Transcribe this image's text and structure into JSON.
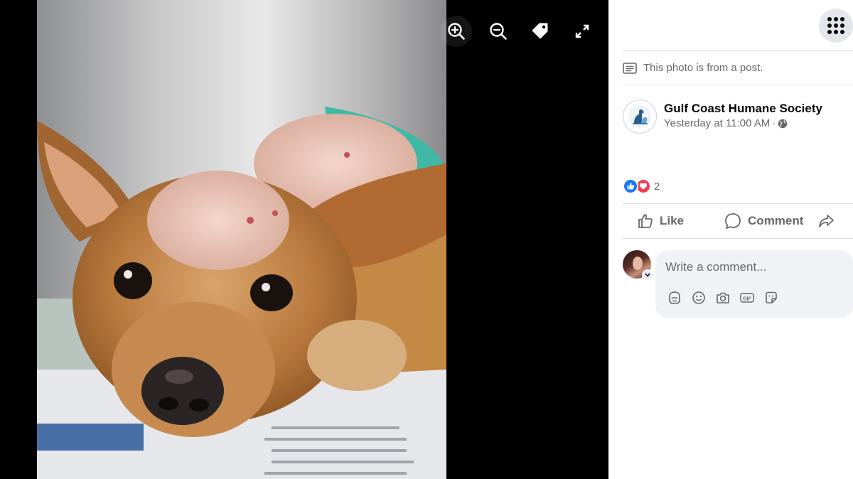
{
  "viewer": {
    "photo_alt": "",
    "tools": [
      {
        "icon": "zoom-in-icon"
      },
      {
        "icon": "zoom-out-icon"
      },
      {
        "icon": "tag-icon"
      },
      {
        "icon": "fullscreen-icon"
      }
    ]
  },
  "panel": {
    "menu_icon": "grid-menu-icon",
    "post_note": "This photo is from a post.",
    "author": {
      "name": "Gulf Coast Humane Society",
      "time": "Yesterday at 11:00 AM",
      "separator": "·",
      "audience_icon": "globe-icon"
    },
    "reactions": {
      "types": [
        "like",
        "love"
      ],
      "count": "2"
    },
    "actions": {
      "like_label": "Like",
      "comment_label": "Comment",
      "share_label": ""
    },
    "comment": {
      "placeholder": "Write a comment...",
      "tools": [
        "avatar-sticker-icon",
        "emoji-icon",
        "camera-icon",
        "gif-icon",
        "sticker-icon"
      ]
    }
  },
  "colors": {
    "viewer_bg": "#000000",
    "panel_bg": "#ffffff",
    "text_secondary": "#65676b",
    "like_blue": "#1877f2",
    "love_red": "#f33e58",
    "input_bg": "#f0f2f5"
  }
}
